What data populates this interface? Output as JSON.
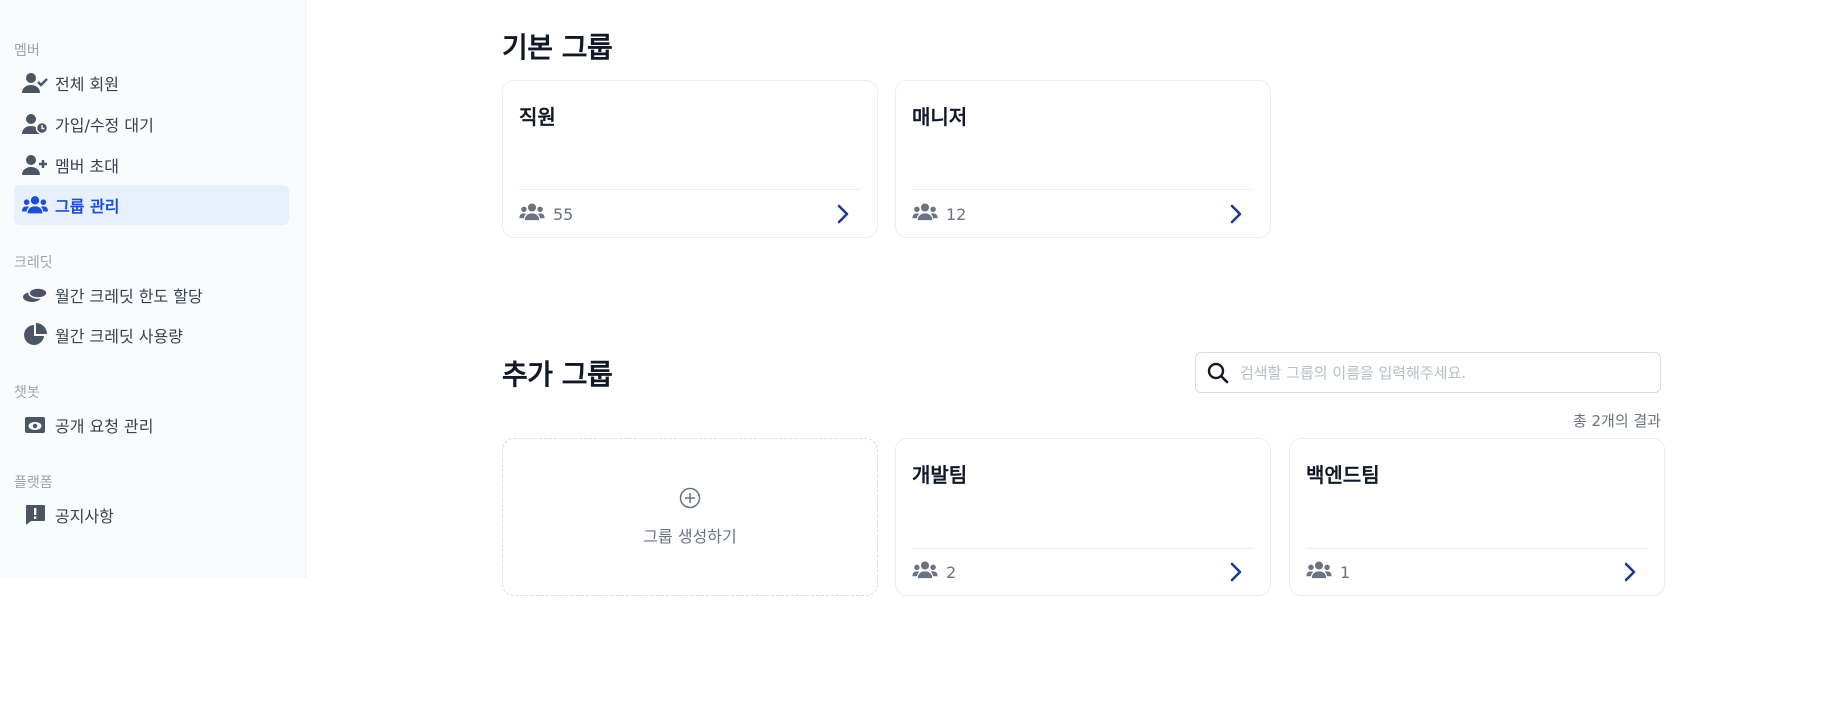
{
  "sidebar": {
    "sections": [
      {
        "label": "멤버",
        "items": [
          {
            "label": "전체 회원",
            "icon": "user-check-icon"
          },
          {
            "label": "가입/수정 대기",
            "icon": "user-clock-icon"
          },
          {
            "label": "멤버 초대",
            "icon": "user-plus-icon"
          },
          {
            "label": "그룹 관리",
            "icon": "users-icon",
            "active": true
          }
        ]
      },
      {
        "label": "크레딧",
        "items": [
          {
            "label": "월간 크레딧 한도 할당",
            "icon": "coins-icon"
          },
          {
            "label": "월간 크레딧 사용량",
            "icon": "pie-chart-icon"
          }
        ]
      },
      {
        "label": "챗봇",
        "items": [
          {
            "label": "공개 요청 관리",
            "icon": "eye-window-icon"
          }
        ]
      },
      {
        "label": "플랫폼",
        "items": [
          {
            "label": "공지사항",
            "icon": "alert-message-icon"
          }
        ]
      }
    ]
  },
  "main": {
    "default_groups": {
      "title": "기본 그룹",
      "cards": [
        {
          "name": "직원",
          "count": "55"
        },
        {
          "name": "매니저",
          "count": "12"
        }
      ]
    },
    "additional_groups": {
      "title": "추가 그룹",
      "search": {
        "placeholder": "검색할 그룹의 이름을 입력해주세요."
      },
      "result_count": "총 2개의 결과",
      "create_label": "그룹 생성하기",
      "cards": [
        {
          "name": "개발팀",
          "count": "2"
        },
        {
          "name": "백엔드팀",
          "count": "1"
        }
      ]
    }
  },
  "colors": {
    "accent": "#1d4ed8",
    "active_bg": "#e8f0fe",
    "icon_gray": "#6b7280",
    "chevron": "#1e3a8a"
  }
}
